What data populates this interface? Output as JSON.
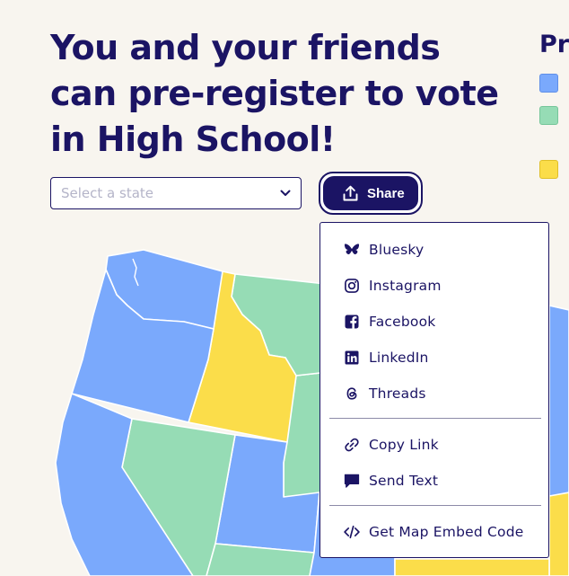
{
  "hero": {
    "title": "You and your friends can pre-register to vote in High School!"
  },
  "legend": {
    "title_visible": "Pr",
    "swatches": [
      {
        "name": "blue",
        "color": "#7aa9fc"
      },
      {
        "name": "green",
        "color": "#96dcb5"
      },
      {
        "name": "yellow",
        "color": "#fbdd4a"
      }
    ]
  },
  "state_select": {
    "placeholder": "Select a state",
    "value": ""
  },
  "share": {
    "label": "Share",
    "menu": [
      {
        "label": "Bluesky",
        "icon": "bluesky-icon"
      },
      {
        "label": "Instagram",
        "icon": "instagram-icon"
      },
      {
        "label": "Facebook",
        "icon": "facebook-icon"
      },
      {
        "label": "LinkedIn",
        "icon": "linkedin-icon"
      },
      {
        "label": "Threads",
        "icon": "threads-icon"
      },
      {
        "label": "Copy Link",
        "icon": "link-icon"
      },
      {
        "label": "Send Text",
        "icon": "chat-bubble-icon"
      },
      {
        "label": "Get Map Embed Code",
        "icon": "code-icon"
      }
    ]
  },
  "map": {
    "states": [
      {
        "name": "washington",
        "color": "#7aa9fc"
      },
      {
        "name": "oregon",
        "color": "#7aa9fc"
      },
      {
        "name": "california",
        "color": "#7aa9fc"
      },
      {
        "name": "idaho",
        "color": "#fbdd4a"
      },
      {
        "name": "montana",
        "color": "#96dcb5"
      },
      {
        "name": "nevada",
        "color": "#96dcb5"
      },
      {
        "name": "utah",
        "color": "#7aa9fc"
      },
      {
        "name": "wyoming",
        "color": "#96dcb5"
      },
      {
        "name": "arizona",
        "color": "#96dcb5"
      }
    ]
  }
}
